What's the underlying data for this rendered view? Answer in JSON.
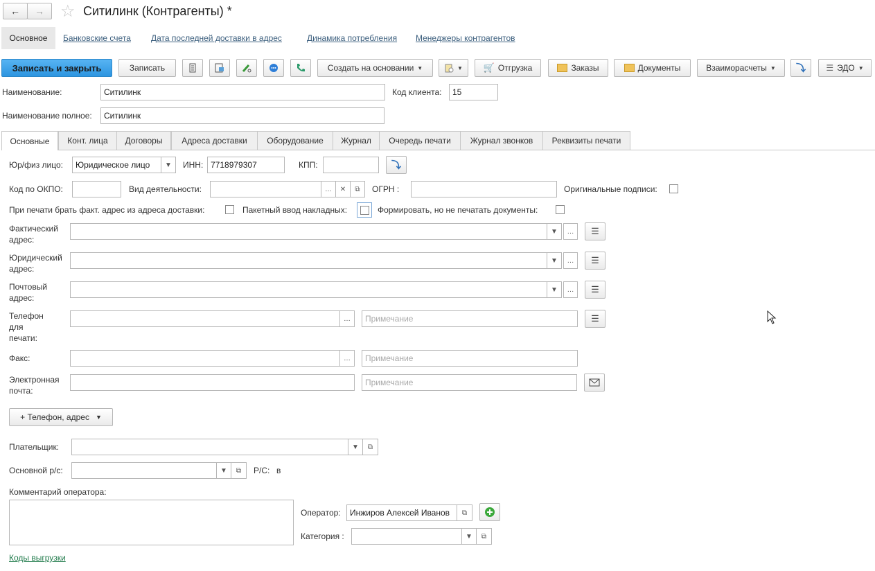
{
  "window": {
    "title": "Ситилинк (Контрагенты) *"
  },
  "nav": {
    "items": [
      "Основное",
      "Банковские счета",
      "Дата последней доставки в адрес",
      "Динамика потребления",
      "Менеджеры контрагентов"
    ]
  },
  "toolbar": {
    "save_close": "Записать и закрыть",
    "save": "Записать",
    "create_based": "Создать на основании",
    "shipment": "Отгрузка",
    "orders": "Заказы",
    "documents": "Документы",
    "settlements": "Взаиморасчеты",
    "edo": "ЭДО"
  },
  "header": {
    "name_label": "Наименование:",
    "name_value": "Ситилинк",
    "client_code_label": "Код клиента:",
    "client_code_value": "15",
    "full_name_label": "Наименование полное:",
    "full_name_value": "Ситилинк"
  },
  "tabs": [
    "Основные",
    "Конт. лица",
    "Договоры",
    "Адреса доставки",
    "Оборудование",
    "Журнал",
    "Очередь печати",
    "Журнал звонков",
    "Реквизиты печати"
  ],
  "form": {
    "person_type_label": "Юр/физ  лицо:",
    "person_type_value": "Юридическое лицо",
    "inn_label": "ИНН:",
    "inn_value": "7718979307",
    "kpp_label": "КПП:",
    "kpp_value": "",
    "okpo_label": "Код по ОКПО:",
    "activity_label": "Вид деятельности:",
    "ogrn_label": "ОГРН   :",
    "orig_sign_label": "Оригинальные подписи:",
    "print_fact_label": "При печати брать факт. адрес из адреса доставки:",
    "batch_label": "Пакетный ввод накладных:",
    "form_noprint_label": "Формировать, но не печатать документы:",
    "fact_addr_label": "Фактический адрес:",
    "legal_addr_label": "Юридический адрес:",
    "post_addr_label": "Почтовый адрес:",
    "phone_label": "Телефон для печати:",
    "fax_label": "Факс:",
    "email_label": "Электронная почта:",
    "note_placeholder": "Примечание",
    "add_contact": "+ Телефон, адрес",
    "payer_label": "Плательщик:",
    "main_account_label": "Основной р/с:",
    "rs_label": "Р/С:",
    "rs_value": "в",
    "comment_label": "Комментарий оператора:",
    "operator_label": "Оператор:",
    "operator_value": "Инжиров Алексей Иванов",
    "category_label": "Категория :",
    "export_codes": "Коды выгрузки"
  },
  "colors": {
    "primary": "#2d95e0",
    "link": "#3c5f7e",
    "green": "#3aa83a"
  }
}
